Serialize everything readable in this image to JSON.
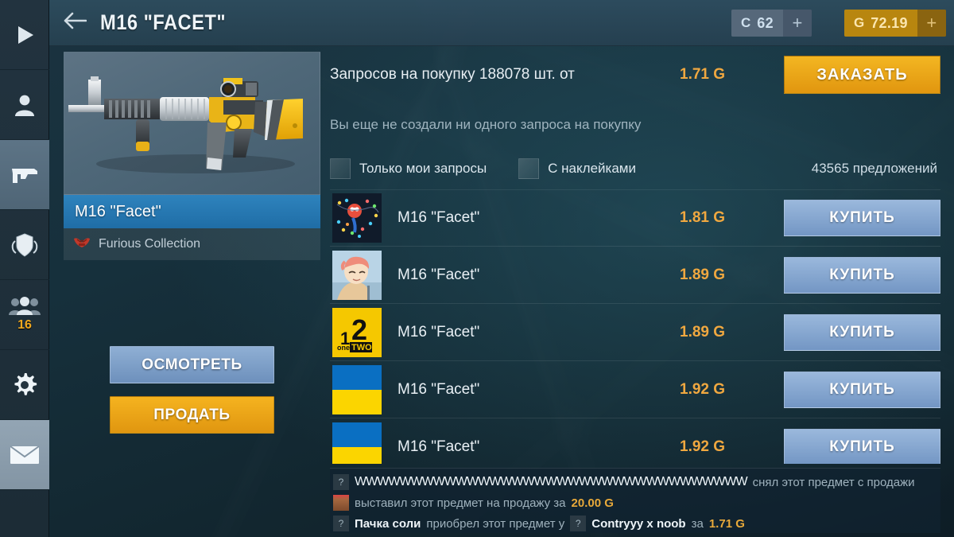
{
  "header": {
    "back_icon": "back-arrow-icon",
    "title": "M16 \"FACET\"",
    "credits": {
      "symbol": "C",
      "value": "62",
      "plus": "+"
    },
    "gold": {
      "symbol": "G",
      "value": "72.19",
      "plus": "+"
    }
  },
  "sidebar": {
    "items": [
      {
        "icon": "play-icon",
        "name": "play"
      },
      {
        "icon": "person-icon",
        "name": "profile"
      },
      {
        "icon": "pistol-icon",
        "name": "weapons"
      },
      {
        "icon": "shield-laurel-icon",
        "name": "rank"
      },
      {
        "icon": "friends-icon",
        "name": "friends",
        "badge": "16"
      },
      {
        "icon": "gear-icon",
        "name": "settings"
      },
      {
        "icon": "envelope-icon",
        "name": "mail"
      }
    ]
  },
  "item": {
    "image_alt": "m16-facet-rifle",
    "name": "M16 \"Facet\"",
    "collection": "Furious Collection",
    "collection_icon": "furious-collection-icon",
    "inspect_label": "ОСМОТРЕТЬ",
    "sell_label": "ПРОДАТЬ"
  },
  "market": {
    "order_text": "Запросов на покупку 188078 шт. от",
    "order_price": "1.71 G",
    "order_button": "ЗАКАЗАТЬ",
    "no_orders_text": "Вы еще не создали ни одного запроса на покупку",
    "filter_my_orders": "Только мои запросы",
    "filter_stickers": "С наклейками",
    "offers_count": "43565 предложений",
    "buy_label": "КУПИТЬ",
    "listings": [
      {
        "avatar": "spiderman-lights-avatar",
        "name": "M16 \"Facet\"",
        "price": "1.81 G",
        "buy": "КУПИТЬ"
      },
      {
        "avatar": "anime-pink-hair-avatar",
        "name": "M16 \"Facet\"",
        "price": "1.89 G",
        "buy": "КУПИТЬ"
      },
      {
        "avatar": "one-two-logo-avatar",
        "name": "M16 \"Facet\"",
        "price": "1.89 G",
        "buy": "КУПИТЬ"
      },
      {
        "avatar": "ukraine-flag-avatar",
        "name": "M16 \"Facet\"",
        "price": "1.92 G",
        "buy": "КУПИТЬ"
      },
      {
        "avatar": "ukraine-flag-avatar",
        "name": "M16 \"Facet\"",
        "price": "1.92 G",
        "buy": "КУПИТЬ"
      }
    ]
  },
  "log": {
    "lines": [
      {
        "avatar": "unknown-avatar",
        "user": "WWWWWWWWWWWWWWWWWWWWWWWWWWWWWWWWWWW",
        "text": "снял этот предмет с продажи"
      },
      {
        "avatar": "santa-girl-avatar",
        "user": "",
        "text": "выставил этот предмет на продажу за",
        "amount": "20.00 G"
      },
      {
        "avatar": "unknown-avatar",
        "user": "Пачка соли",
        "text": "приобрел этот предмет у",
        "avatar2": "unknown-avatar",
        "user2": "Contryyy x noob",
        "text2": "за",
        "amount": "1.71 G"
      }
    ]
  },
  "colors": {
    "gold": "#f0a840",
    "button_gold": "#f3b622",
    "button_blue": "#9ab8dc",
    "name_bar_blue": "#1f6da6",
    "bg_teal": "#16303c"
  }
}
